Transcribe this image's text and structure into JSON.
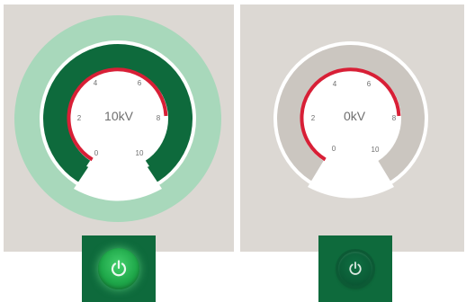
{
  "gauges": [
    {
      "state": "on",
      "readout": "10kV",
      "ticks": [
        "0",
        "2",
        "4",
        "6",
        "8",
        "10"
      ],
      "colors": {
        "outer_ring": "#a8d8bb",
        "body": "#0e6a3c",
        "arc": "#d81f36"
      }
    },
    {
      "state": "off",
      "readout": "0kV",
      "ticks": [
        "0",
        "2",
        "4",
        "6",
        "8",
        "10"
      ],
      "colors": {
        "outer_ring": "#dcd8d3",
        "body": "#cbc6c0",
        "arc": "#d81f36"
      }
    }
  ],
  "power_buttons": [
    {
      "state": "on",
      "icon": "power-icon"
    },
    {
      "state": "off",
      "icon": "power-icon"
    }
  ]
}
